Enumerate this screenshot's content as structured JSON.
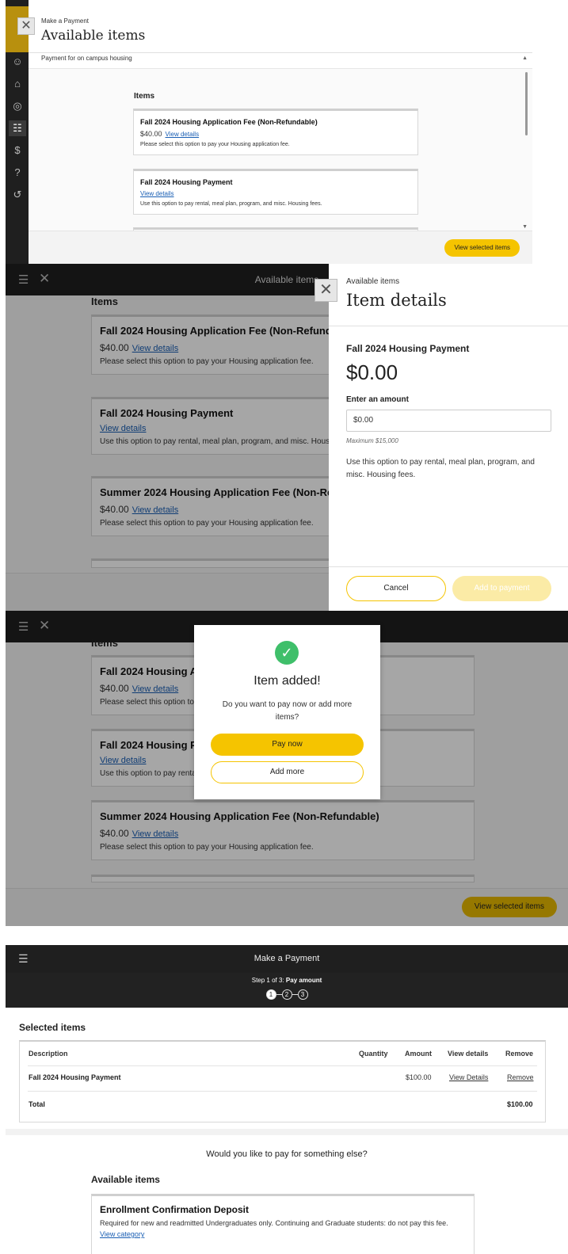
{
  "panel1": {
    "breadcrumb": "Make a Payment",
    "title": "Available items",
    "purpose": "Payment for on campus housing",
    "items_heading": "Items",
    "items": [
      {
        "title": "Fall 2024 Housing Application Fee (Non-Refundable)",
        "price": "$40.00",
        "link": "View details",
        "desc": "Please select this option to pay your Housing application fee."
      },
      {
        "title": "Fall 2024 Housing Payment",
        "link": "View details",
        "desc": "Use this option to pay rental, meal plan, program, and misc. Housing fees."
      }
    ],
    "view_selected": "View selected items"
  },
  "panel2": {
    "topbar_title": "Available items",
    "items_heading": "Items",
    "items": [
      {
        "title": "Fall 2024 Housing Application Fee (Non-Refundable)",
        "price": "$40.00",
        "link": "View details",
        "desc": "Please select this option to pay your Housing application fee."
      },
      {
        "title": "Fall 2024 Housing Payment",
        "link": "View details",
        "desc": "Use this option to pay rental, meal plan, program, and misc. Housing fees."
      },
      {
        "title": "Summer 2024 Housing Application Fee (Non-Refundable)",
        "price": "$40.00",
        "link": "View details",
        "desc": "Please select this option to pay your Housing application fee."
      }
    ],
    "drawer": {
      "breadcrumb": "Available items",
      "title": "Item details",
      "item_name": "Fall 2024 Housing Payment",
      "amount": "$0.00",
      "enter_label": "Enter an amount",
      "input_value": "$0.00",
      "maximum": "Maximum $15,000",
      "description": "Use this option to pay rental, meal plan, program, and misc. Housing fees.",
      "cancel": "Cancel",
      "add": "Add to payment"
    }
  },
  "panel3": {
    "items_heading": "Items",
    "items": [
      {
        "title": "Fall 2024 Housing Application Fee (Non-Refundable)",
        "price": "$40.00",
        "link": "View details",
        "desc": "Please select this option to pay your Housing application fee."
      },
      {
        "title": "Fall 2024 Housing Payment",
        "link": "View details",
        "desc": "Use this option to pay rental, meal plan, program, and misc. Housing fees."
      },
      {
        "title": "Summer 2024 Housing Application Fee (Non-Refundable)",
        "price": "$40.00",
        "link": "View details",
        "desc": "Please select this option to pay your Housing application fee."
      }
    ],
    "modal": {
      "title": "Item added!",
      "text": "Do you want to pay now or add more items?",
      "pay_now": "Pay now",
      "add_more": "Add more"
    },
    "view_selected": "View selected items"
  },
  "panel4": {
    "topbar_title": "Make a Payment",
    "step_prefix": "Step 1 of 3:",
    "step_name": "Pay amount",
    "steps": [
      "1",
      "2",
      "3"
    ],
    "selected_heading": "Selected items",
    "columns": {
      "description": "Description",
      "quantity": "Quantity",
      "amount": "Amount",
      "view_details": "View details",
      "remove": "Remove"
    },
    "row": {
      "description": "Fall 2024 Housing Payment",
      "amount": "$100.00",
      "view_details": "View Details",
      "remove": "Remove"
    },
    "total_label": "Total",
    "total_value": "$100.00",
    "pay_else": "Would you like to pay for something else?",
    "available_heading": "Available items",
    "available_item": {
      "title": "Enrollment Confirmation Deposit",
      "desc": "Required for new and readmitted Undergraduates only. Continuing and Graduate students: do not pay this fee.",
      "link": "View category"
    }
  },
  "colors": {
    "accent": "#f5c400",
    "dark": "#1f1f1f",
    "link": "#1a5fb4",
    "success": "#3fbf6a"
  }
}
